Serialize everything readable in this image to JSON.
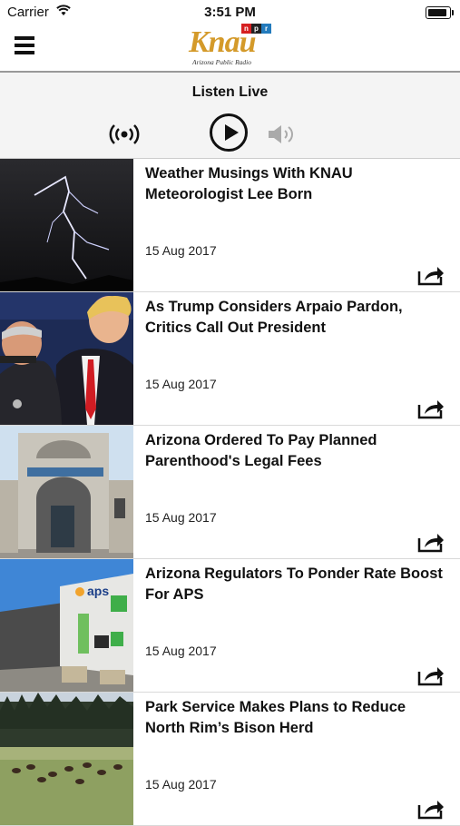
{
  "status_bar": {
    "carrier": "Carrier",
    "time": "3:51 PM"
  },
  "header": {
    "logo": {
      "word": "Knau",
      "npr": [
        "n",
        "p",
        "r"
      ],
      "tagline": "Arizona  Public Radio"
    },
    "menu_icon": "hamburger-menu-icon"
  },
  "player": {
    "title": "Listen Live",
    "icons": [
      "broadcast-icon",
      "play-icon",
      "volume-icon"
    ]
  },
  "colors": {
    "logo_gold": "#d49a2a",
    "npr_red": "#d62021",
    "npr_black": "#222222",
    "npr_blue": "#237bbd"
  },
  "articles": [
    {
      "title": "Weather Musings With KNAU Meteorologist Lee Born",
      "date": "15 Aug 2017"
    },
    {
      "title": "As Trump Considers Arpaio Pardon, Critics Call Out President",
      "date": "15 Aug 2017"
    },
    {
      "title": "Arizona Ordered To Pay Planned Parenthood's Legal Fees",
      "date": "15 Aug 2017"
    },
    {
      "title": "Arizona Regulators To Ponder Rate Boost For APS",
      "date": "15 Aug 2017",
      "thumb_text": "aps"
    },
    {
      "title": "Park Service Makes Plans to Reduce North Rim’s Bison Herd",
      "date": "15 Aug 2017"
    }
  ]
}
